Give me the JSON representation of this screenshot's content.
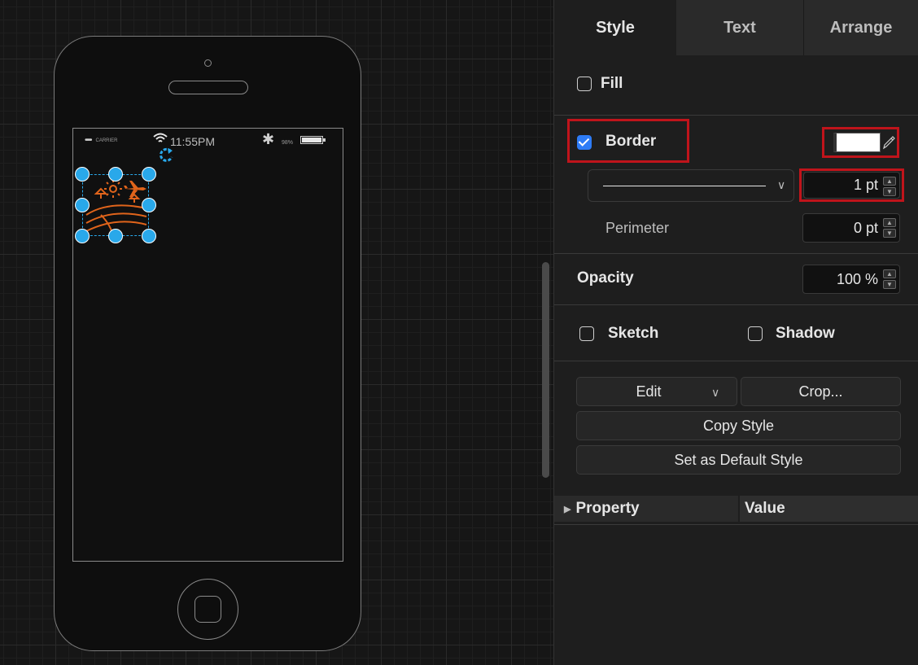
{
  "phone": {
    "carrier_dots": "•••••",
    "carrier_label": "CARRIER",
    "time": "11:55PM",
    "battery_pct": "98%"
  },
  "tabs": [
    {
      "label": "Style",
      "active": true
    },
    {
      "label": "Text",
      "active": false
    },
    {
      "label": "Arrange",
      "active": false
    }
  ],
  "style": {
    "fill_label": "Fill",
    "fill_checked": false,
    "border_label": "Border",
    "border_checked": true,
    "border_color": "#ffffff",
    "line_width": "1 pt",
    "perimeter_label": "Perimeter",
    "perimeter_value": "0 pt",
    "opacity_label": "Opacity",
    "opacity_value": "100 %",
    "sketch_label": "Sketch",
    "sketch_checked": false,
    "shadow_label": "Shadow",
    "shadow_checked": false,
    "edit_label": "Edit",
    "crop_label": "Crop...",
    "copy_style_label": "Copy Style",
    "set_default_label": "Set as Default Style"
  },
  "properties": {
    "property_header": "Property",
    "value_header": "Value"
  },
  "colors": {
    "selection": "#29a8ea",
    "highlight": "#c0141b",
    "checkbox_checked": "#2e7cf6",
    "icon_orange": "#e0641b"
  }
}
